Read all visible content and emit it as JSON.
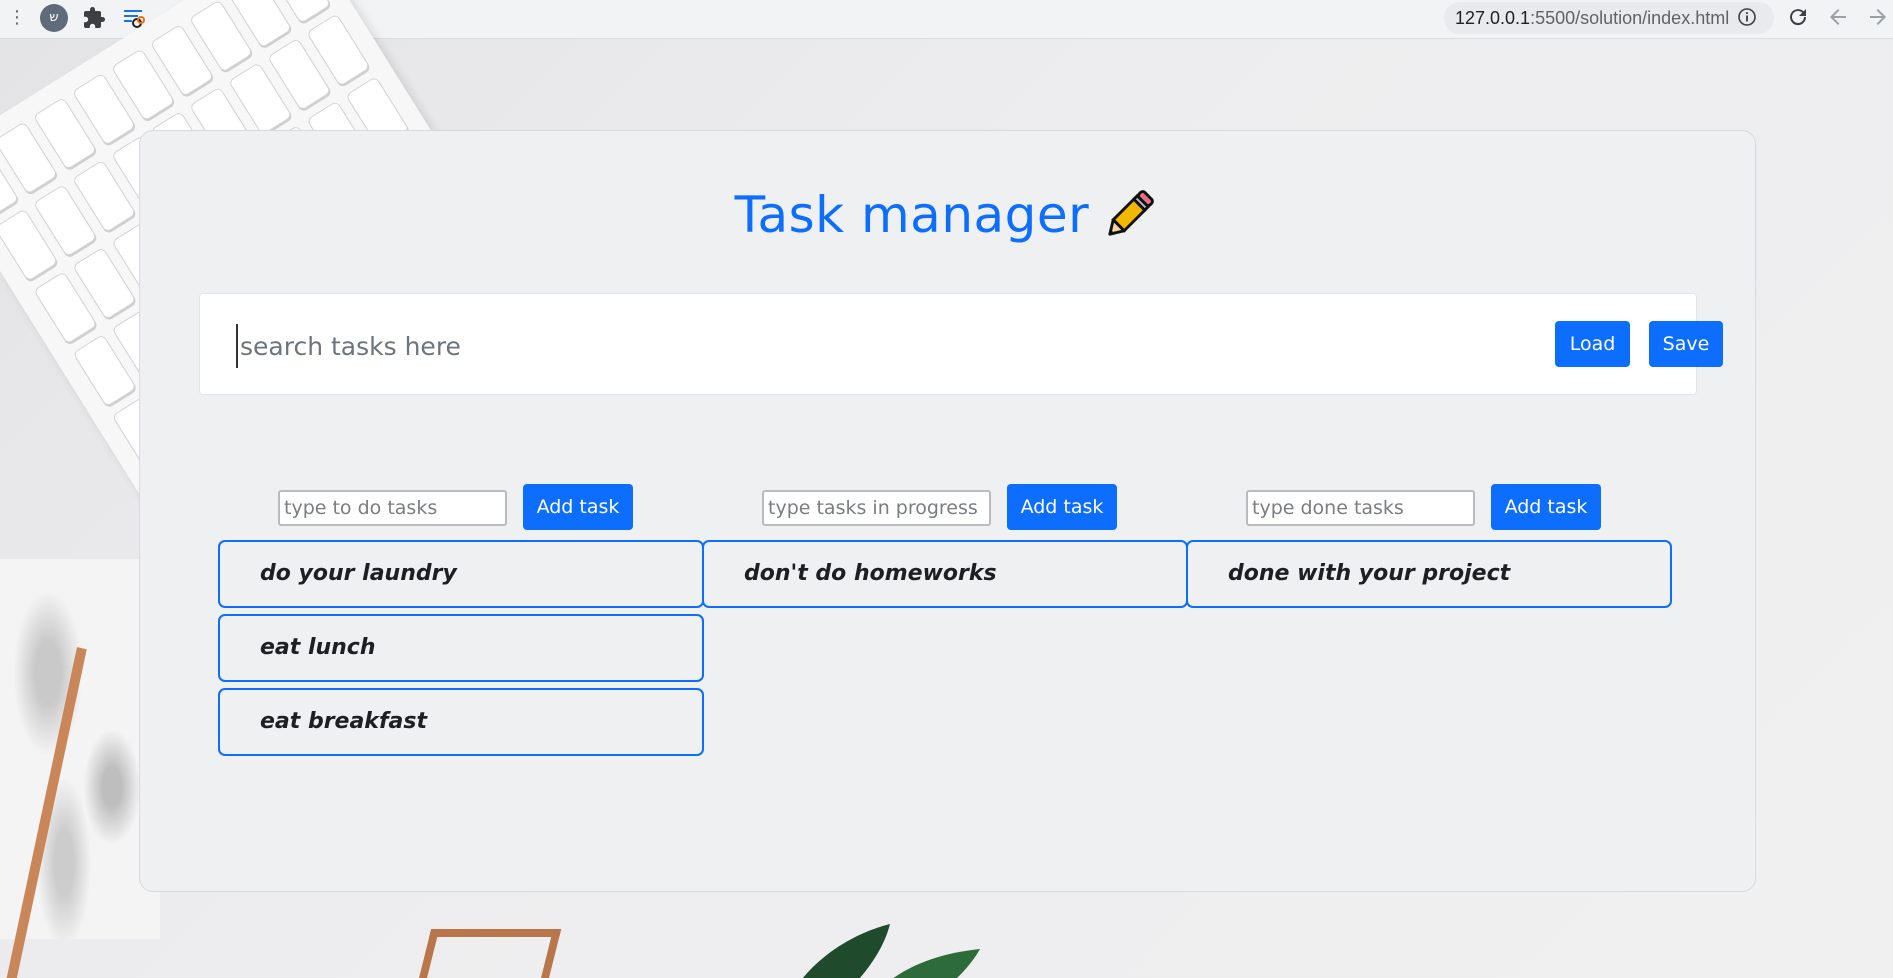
{
  "browser": {
    "profile_initial": "ש",
    "url_host": "127.0.0.1",
    "url_rest": ":5500/solution/index.html",
    "icons": [
      "menu-dots-icon",
      "profile-avatar",
      "extensions-puzzle-icon",
      "reading-list-icon",
      "bookmark-star-icon",
      "site-info-icon",
      "reload-icon",
      "back-icon",
      "forward-icon"
    ]
  },
  "page": {
    "title": "Task manager",
    "title_icon": "pencil-icon",
    "accent_color": "#0d6efd",
    "search": {
      "placeholder": "search tasks here",
      "value": ""
    },
    "toolbar": {
      "load_label": "Load",
      "save_label": "Save"
    }
  },
  "columns": [
    {
      "input_placeholder": "type to do tasks",
      "add_label": "Add task",
      "tasks": [
        "do your laundry",
        "eat lunch",
        "eat breakfast"
      ]
    },
    {
      "input_placeholder": "type tasks in progress",
      "add_label": "Add task",
      "tasks": [
        "don't do homeworks"
      ]
    },
    {
      "input_placeholder": "type done tasks",
      "add_label": "Add task",
      "tasks": [
        "done with your project"
      ]
    }
  ]
}
